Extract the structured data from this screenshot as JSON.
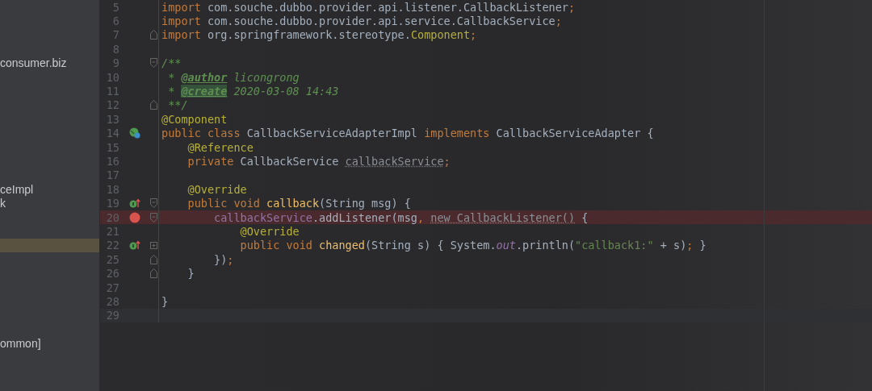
{
  "project_panel": {
    "rows": [
      {
        "label": "consumer.biz",
        "selected": false
      },
      {
        "label": "ceImpl",
        "selected": false
      },
      {
        "label": "k",
        "selected": false
      },
      {
        "selected": true
      },
      {
        "label": "ommon]",
        "selected": false
      }
    ]
  },
  "editor": {
    "lines": [
      {
        "number": "5",
        "tokens": [
          {
            "kind": "kw",
            "text": "import"
          },
          {
            "kind": "pl",
            "text": " com.souche.dubbo.provider.api.listener.CallbackListener"
          },
          {
            "kind": "kw",
            "text": ";"
          }
        ]
      },
      {
        "number": "6",
        "tokens": [
          {
            "kind": "kw",
            "text": "import"
          },
          {
            "kind": "pl",
            "text": " com.souche.dubbo.provider.api.service.CallbackService"
          },
          {
            "kind": "kw",
            "text": ";"
          }
        ]
      },
      {
        "number": "7",
        "fold": {
          "kind": "end"
        },
        "tokens": [
          {
            "kind": "kw",
            "text": "import"
          },
          {
            "kind": "pl",
            "text": " org.springframework.stereotype."
          },
          {
            "kind": "ann",
            "text": "Component"
          },
          {
            "kind": "kw",
            "text": ";"
          }
        ]
      },
      {
        "number": "8"
      },
      {
        "number": "9",
        "fold": {
          "kind": "start"
        },
        "tokens": [
          {
            "kind": "doc",
            "text": "/**"
          }
        ]
      },
      {
        "number": "10",
        "tokens": [
          {
            "kind": "doc",
            "text": " * "
          },
          {
            "kind": "tag",
            "text": "@author"
          },
          {
            "kind": "doc",
            "text": " licongrong"
          }
        ]
      },
      {
        "number": "11",
        "tokens": [
          {
            "kind": "doc",
            "text": " * "
          },
          {
            "kind": "taghl",
            "text": "@create"
          },
          {
            "kind": "doc",
            "text": " 2020-03-08 14:43"
          }
        ]
      },
      {
        "number": "12",
        "fold": {
          "kind": "end"
        },
        "tokens": [
          {
            "kind": "doc",
            "text": " **/"
          }
        ]
      },
      {
        "number": "13",
        "tokens": [
          {
            "kind": "ann",
            "text": "@Component"
          }
        ]
      },
      {
        "number": "14",
        "gutter": {
          "kind": "implemented"
        },
        "tokens": [
          {
            "kind": "kw",
            "text": "public class "
          },
          {
            "kind": "pl",
            "text": "CallbackServiceAdapterImpl "
          },
          {
            "kind": "kw",
            "text": "implements "
          },
          {
            "kind": "pl",
            "text": "CallbackServiceAdapter {"
          }
        ]
      },
      {
        "number": "15",
        "tokens": [
          {
            "kind": "ann",
            "text": "    @Reference"
          }
        ]
      },
      {
        "number": "16",
        "tokens": [
          {
            "kind": "kw",
            "text": "    private "
          },
          {
            "kind": "pl",
            "text": "CallbackService "
          },
          {
            "kind": "warn",
            "text": "callbackService"
          },
          {
            "kind": "kw",
            "text": ";"
          }
        ]
      },
      {
        "number": "17"
      },
      {
        "number": "18",
        "tokens": [
          {
            "kind": "ann",
            "text": "    @Override"
          }
        ]
      },
      {
        "number": "19",
        "gutter": {
          "kind": "override"
        },
        "fold": {
          "kind": "start"
        },
        "tokens": [
          {
            "kind": "kw",
            "text": "    public void "
          },
          {
            "kind": "decl",
            "text": "callback"
          },
          {
            "kind": "pl",
            "text": "(String msg) {"
          }
        ]
      },
      {
        "number": "20",
        "gutter": {
          "kind": "breakpoint"
        },
        "fold": {
          "kind": "start"
        },
        "tokens": [
          {
            "kind": "field",
            "text": "        callbackService"
          },
          {
            "kind": "pl",
            "text": ".addListener(msg"
          },
          {
            "kind": "kw",
            "text": ", "
          },
          {
            "kind": "warn",
            "text": "new CallbackListener()"
          },
          {
            "kind": "pl",
            "text": " {"
          }
        ]
      },
      {
        "number": "21",
        "tokens": [
          {
            "kind": "ann",
            "text": "            @Override"
          }
        ]
      },
      {
        "number": "22",
        "gutter": {
          "kind": "override"
        },
        "fold": {
          "kind": "collapsed"
        },
        "tokens": [
          {
            "kind": "kw",
            "text": "            public void "
          },
          {
            "kind": "decl",
            "text": "changed"
          },
          {
            "kind": "pl",
            "text": "(String s) { System."
          },
          {
            "kind": "static",
            "text": "out"
          },
          {
            "kind": "pl",
            "text": ".println("
          },
          {
            "kind": "str",
            "text": "\"callback1:\""
          },
          {
            "kind": "pl",
            "text": " + s)"
          },
          {
            "kind": "kw",
            "text": ";"
          },
          {
            "kind": "pl",
            "text": " }"
          }
        ]
      },
      {
        "number": "25",
        "fold": {
          "kind": "end"
        },
        "tokens": [
          {
            "kind": "pl",
            "text": "        })"
          },
          {
            "kind": "kw",
            "text": ";"
          }
        ]
      },
      {
        "number": "26",
        "fold": {
          "kind": "end"
        },
        "tokens": [
          {
            "kind": "pl",
            "text": "    }"
          }
        ]
      },
      {
        "number": "27"
      },
      {
        "number": "28",
        "tokens": [
          {
            "kind": "pl",
            "text": "}"
          }
        ]
      },
      {
        "number": "29",
        "current": true
      }
    ]
  }
}
